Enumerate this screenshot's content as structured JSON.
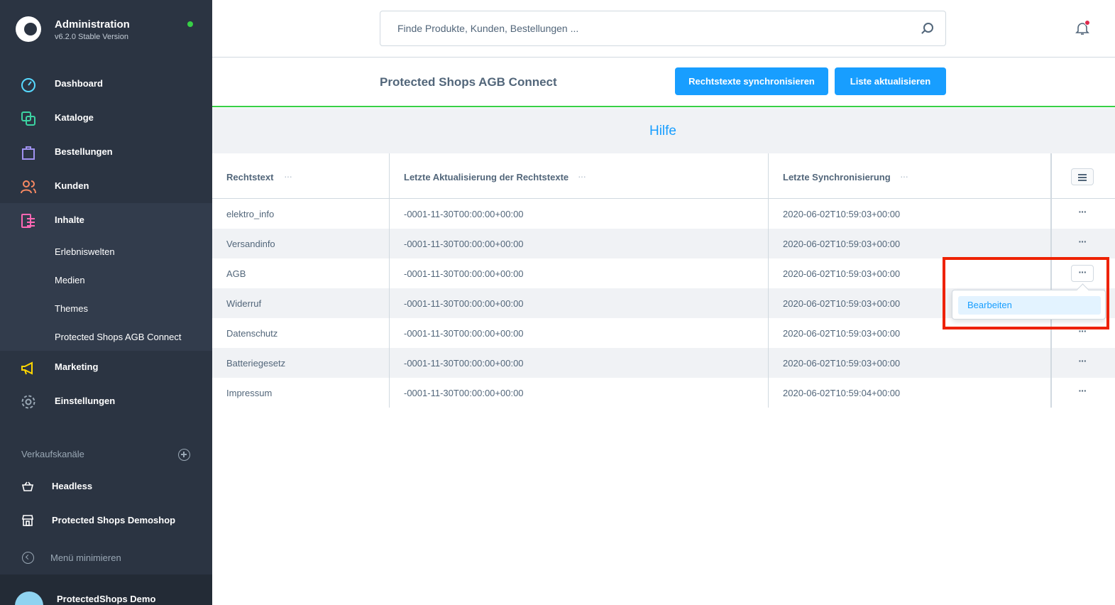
{
  "app": {
    "title": "Administration",
    "version": "v6.2.0 Stable Version"
  },
  "sidebar": {
    "nav": [
      {
        "label": "Dashboard",
        "icon": "dashboard-icon",
        "color": "#57d9ff"
      },
      {
        "label": "Kataloge",
        "icon": "catalog-icon",
        "color": "#3cd3a2"
      },
      {
        "label": "Bestellungen",
        "icon": "orders-icon",
        "color": "#a092f0"
      },
      {
        "label": "Kunden",
        "icon": "customers-icon",
        "color": "#f88962"
      },
      {
        "label": "Inhalte",
        "icon": "content-icon",
        "color": "#ff68b4"
      },
      {
        "label": "Marketing",
        "icon": "marketing-icon",
        "color": "#ffd700"
      },
      {
        "label": "Einstellungen",
        "icon": "settings-icon",
        "color": "#9aa8b5"
      }
    ],
    "content_children": [
      "Erlebniswelten",
      "Medien",
      "Themes",
      "Protected Shops AGB Connect"
    ],
    "sales_channels_title": "Verkaufskanäle",
    "sales_channels": [
      {
        "label": "Headless",
        "icon": "basket-icon"
      },
      {
        "label": "Protected Shops Demoshop",
        "icon": "storefront-icon"
      }
    ],
    "minimize_label": "Menü minimieren",
    "user_name": "ProtectedShops Demo"
  },
  "search": {
    "placeholder": "Finde Produkte, Kunden, Bestellungen ..."
  },
  "page": {
    "title": "Protected Shops AGB Connect",
    "sync_button": "Rechtstexte synchronisieren",
    "refresh_button": "Liste aktualisieren",
    "help_link": "Hilfe"
  },
  "grid": {
    "columns": [
      "Rechtstext",
      "Letzte Aktualisierung der Rechtstexte",
      "Letzte Synchronisierung"
    ],
    "rows": [
      {
        "name": "elektro_info",
        "updated": "-0001-11-30T00:00:00+00:00",
        "synced": "2020-06-02T10:59:03+00:00"
      },
      {
        "name": "Versandinfo",
        "updated": "-0001-11-30T00:00:00+00:00",
        "synced": "2020-06-02T10:59:03+00:00"
      },
      {
        "name": "AGB",
        "updated": "-0001-11-30T00:00:00+00:00",
        "synced": "2020-06-02T10:59:03+00:00"
      },
      {
        "name": "Widerruf",
        "updated": "-0001-11-30T00:00:00+00:00",
        "synced": "2020-06-02T10:59:03+00:00"
      },
      {
        "name": "Datenschutz",
        "updated": "-0001-11-30T00:00:00+00:00",
        "synced": "2020-06-02T10:59:03+00:00"
      },
      {
        "name": "Batteriegesetz",
        "updated": "-0001-11-30T00:00:00+00:00",
        "synced": "2020-06-02T10:59:03+00:00"
      },
      {
        "name": "Impressum",
        "updated": "-0001-11-30T00:00:00+00:00",
        "synced": "2020-06-02T10:59:04+00:00"
      }
    ],
    "row_action_label": "···",
    "column_menu_label": "···",
    "context_menu": {
      "item": "Bearbeiten",
      "open_row": 2
    }
  },
  "colors": {
    "primary": "#189eff",
    "sidebar_bg": "#2b3442",
    "accent_green": "#37d046",
    "highlight": "#ee2200"
  }
}
